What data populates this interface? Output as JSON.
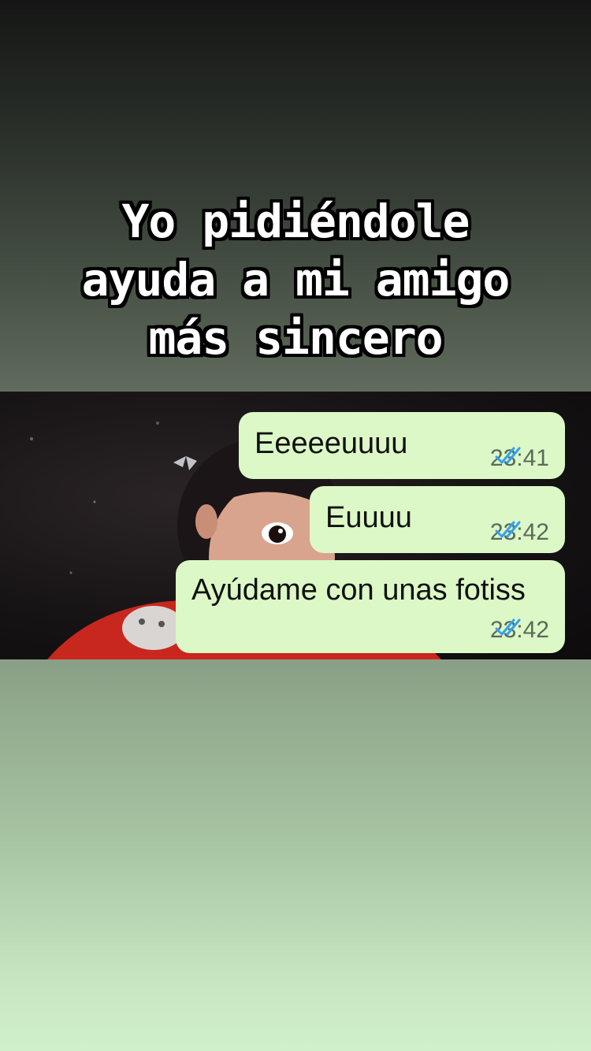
{
  "caption": {
    "line1": "Yo pidiéndole",
    "line2": "ayuda a mi amigo",
    "line3": "más sincero"
  },
  "messages": [
    {
      "text": "Eeeeeuuuu",
      "time": "23:41",
      "status": "read-double-check-icon"
    },
    {
      "text": "Euuuu",
      "time": "23:42",
      "status": "read-double-check-icon"
    },
    {
      "text": "Ayúdame con unas fotiss",
      "time": "23:42",
      "status": "read-double-check-icon"
    }
  ],
  "colors": {
    "bubble": "#dcf8c6",
    "read_ticks": "#34a0f0",
    "caption_text": "#ffffff",
    "caption_outline": "#000000"
  }
}
